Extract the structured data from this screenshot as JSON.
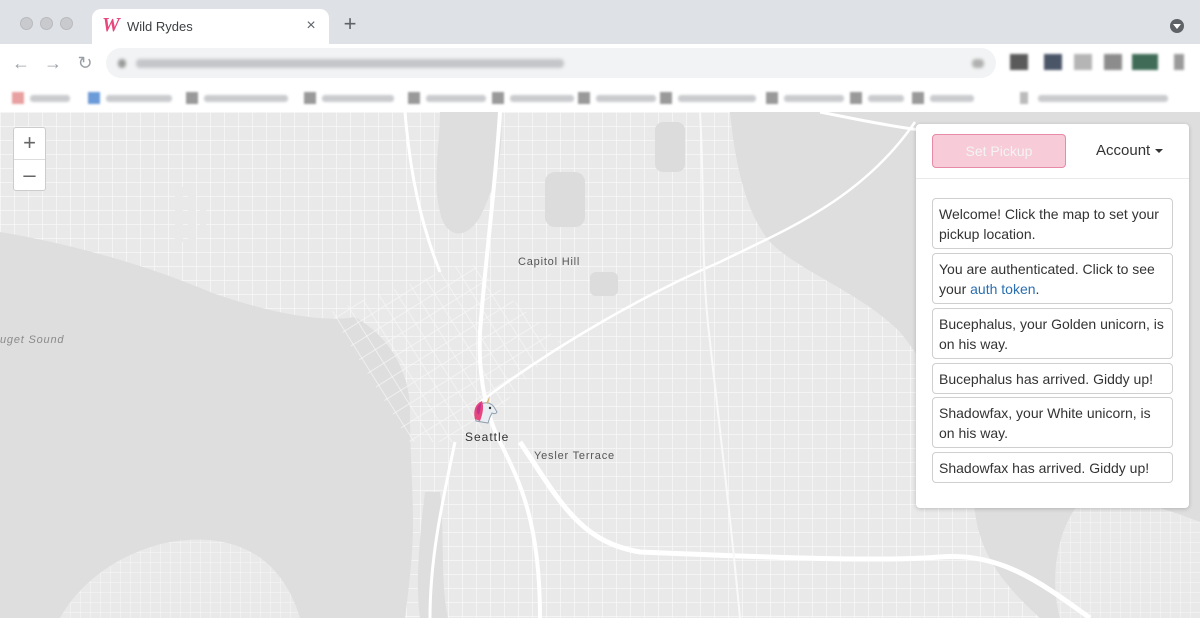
{
  "browser": {
    "tab": {
      "title": "Wild Rydes",
      "favicon_glyph": "W",
      "close_glyph": "×"
    },
    "new_tab_glyph": "+",
    "nav": {
      "back": "←",
      "forward": "→",
      "reload": "↻"
    }
  },
  "map": {
    "labels": {
      "capitol_hill": "Capitol Hill",
      "puget_sound": "uget Sound",
      "seattle": "Seattle",
      "yesler_terrace": "Yesler Terrace"
    },
    "zoom": {
      "in": "+",
      "out": "–"
    }
  },
  "panel": {
    "set_pickup_label": "Set Pickup",
    "account_label": "Account",
    "messages": [
      {
        "text": "Welcome! Click the map to set your pickup location."
      },
      {
        "text_before": "You are authenticated. Click to see your ",
        "link": "auth token",
        "text_after": "."
      },
      {
        "text": "Bucephalus, your Golden unicorn, is on his way."
      },
      {
        "text": "Bucephalus has arrived. Giddy up!"
      },
      {
        "text": "Shadowfax, your White unicorn, is on his way."
      },
      {
        "text": "Shadowfax has arrived. Giddy up!"
      }
    ]
  },
  "colors": {
    "brand_pink": "#e8477e",
    "button_pink": "#f7cbd8",
    "link_blue": "#2a6fb0",
    "water": "#dedede",
    "land": "#e9e9e9"
  }
}
